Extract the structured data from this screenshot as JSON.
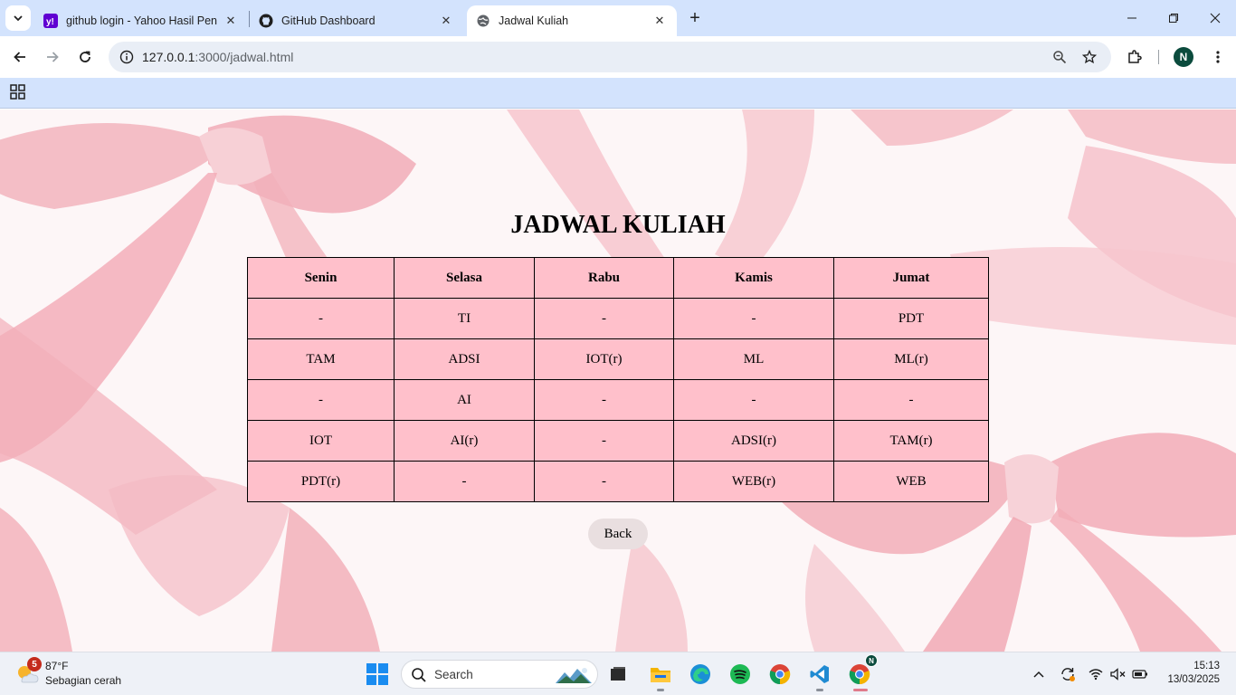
{
  "browser": {
    "tabs": [
      {
        "title": "github login - Yahoo Hasil Penc",
        "favicon": "yahoo-icon"
      },
      {
        "title": "GitHub Dashboard",
        "favicon": "github-icon"
      },
      {
        "title": "Jadwal Kuliah",
        "favicon": "globe-icon"
      }
    ],
    "active_tab": 2,
    "url_host": "127.0.0.1",
    "url_path": ":3000/jadwal.html",
    "profile_initial": "N"
  },
  "page": {
    "title": "JADWAL KULIAH",
    "table": {
      "headers": [
        "Senin",
        "Selasa",
        "Rabu",
        "Kamis",
        "Jumat"
      ],
      "rows": [
        [
          "-",
          "TI",
          "-",
          "-",
          "PDT"
        ],
        [
          "TAM",
          "ADSI",
          "IOT(r)",
          "ML",
          "ML(r)"
        ],
        [
          "-",
          "AI",
          "-",
          "-",
          "-"
        ],
        [
          "IOT",
          "AI(r)",
          "-",
          "ADSI(r)",
          "TAM(r)"
        ],
        [
          "PDT(r)",
          "-",
          "-",
          "WEB(r)",
          "WEB"
        ]
      ]
    },
    "back_label": "Back",
    "colors": {
      "cell_background": "#ffc0cb",
      "button_background": "#e9dfe0"
    }
  },
  "taskbar": {
    "weather": {
      "badge": "5",
      "temperature": "87°F",
      "condition": "Sebagian cerah"
    },
    "search_placeholder": "Search",
    "apps": [
      "task-view-icon",
      "file-explorer-icon",
      "edge-icon",
      "spotify-icon",
      "chrome-icon",
      "vscode-icon",
      "chrome-profile-icon"
    ],
    "chrome_profile_badge": "N",
    "time": "15:13",
    "date": "13/03/2025"
  }
}
